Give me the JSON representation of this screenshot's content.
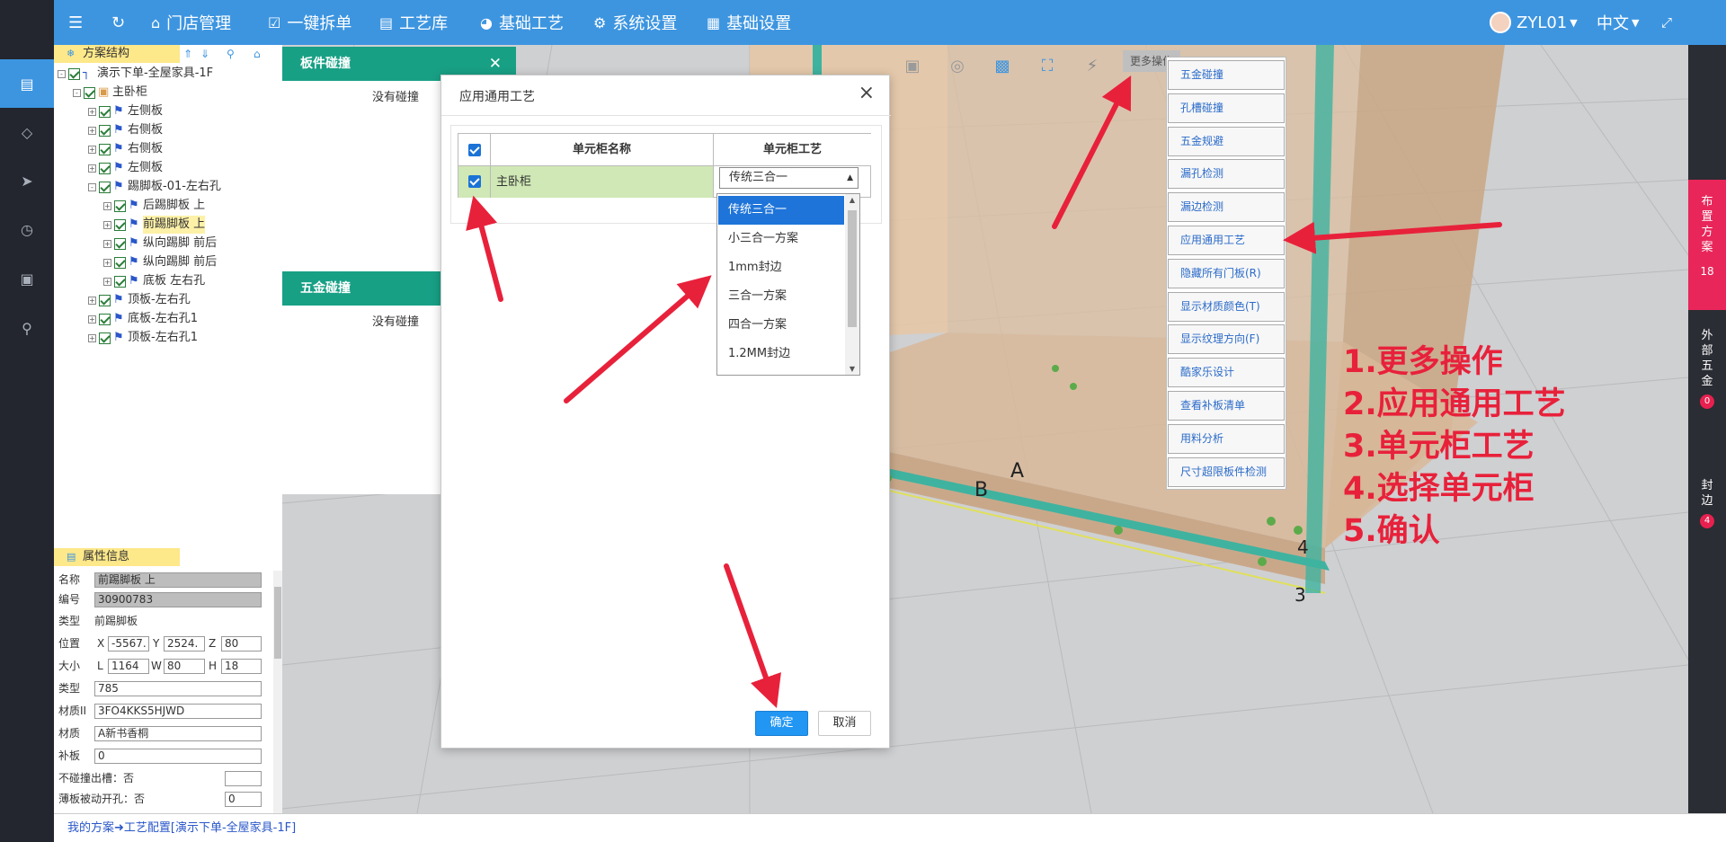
{
  "topbar": {
    "items": [
      {
        "icon": "menu-icon",
        "label": ""
      },
      {
        "icon": "refresh-icon",
        "label": ""
      },
      {
        "icon": "home-icon",
        "label": "门店管理"
      },
      {
        "icon": "shield-check-icon",
        "label": "一键拆单"
      },
      {
        "icon": "book-icon",
        "label": "工艺库"
      },
      {
        "icon": "gauge-icon",
        "label": "基础工艺"
      },
      {
        "icon": "gear-icon",
        "label": "系统设置"
      },
      {
        "icon": "grid-icon",
        "label": "基础设置"
      }
    ],
    "user": "ZYL01",
    "language": "中文",
    "color": "#3d95e0"
  },
  "left_nav_icons": [
    "layout-icon",
    "diamond-icon",
    "send-icon",
    "clock-icon",
    "trash-icon",
    "search-icon"
  ],
  "tree_panel": {
    "title": "方案结构",
    "nodes": [
      {
        "label": "演示下单-全屋家具-1F",
        "level": 0,
        "exp": "-",
        "icon": "r"
      },
      {
        "label": "主卧柜",
        "level": 1,
        "exp": "-",
        "icon": "box"
      },
      {
        "label": "左侧板",
        "level": 2,
        "exp": "+",
        "icon": "flag"
      },
      {
        "label": "右侧板",
        "level": 2,
        "exp": "+",
        "icon": "flag"
      },
      {
        "label": "右侧板",
        "level": 2,
        "exp": "+",
        "icon": "flag"
      },
      {
        "label": "左侧板",
        "level": 2,
        "exp": "+",
        "icon": "flag"
      },
      {
        "label": "踢脚板-01-左右孔",
        "level": 2,
        "exp": "-",
        "icon": "flag"
      },
      {
        "label": "后踢脚板 上",
        "level": 3,
        "exp": "+",
        "icon": "flag"
      },
      {
        "label": "前踢脚板 上",
        "level": 3,
        "exp": "+",
        "icon": "flag",
        "selected": true
      },
      {
        "label": "纵向踢脚 前后",
        "level": 3,
        "exp": "+",
        "icon": "flag"
      },
      {
        "label": "纵向踢脚 前后",
        "level": 3,
        "exp": "+",
        "icon": "flag"
      },
      {
        "label": "底板 左右孔",
        "level": 3,
        "exp": "+",
        "icon": "flag"
      },
      {
        "label": "顶板-左右孔",
        "level": 2,
        "exp": "+",
        "icon": "flag"
      },
      {
        "label": "底板-左右孔1",
        "level": 2,
        "exp": "+",
        "icon": "flag"
      },
      {
        "label": "顶板-左右孔1",
        "level": 2,
        "exp": "+",
        "icon": "flag"
      }
    ]
  },
  "props_panel": {
    "title": "属性信息",
    "name_label": "名称",
    "name_value": "前踢脚板 上",
    "code_label": "编号",
    "code_value": "30900783",
    "type_label": "类型",
    "type_value": "前踢脚板",
    "pos_label": "位置",
    "x_label": "X",
    "x_value": "-5567.",
    "y_label": "Y",
    "y_value": "2524.",
    "z_label": "Z",
    "z_value": "80",
    "size_label": "大小",
    "l_label": "L",
    "l_value": "1164",
    "w_label": "W",
    "w_value": "80",
    "h_label": "H",
    "h_value": "18",
    "kind_label": "类型",
    "kind_value": "785",
    "matid_label": "材质II",
    "matid_value": "3FO4KKS5HJWD",
    "mat_label": "材质",
    "mat_value": "A新书香桐",
    "patch_label": "补板",
    "patch_value": "0",
    "nocollide_label": "不碰撞出槽：否",
    "thin_label": "薄板被动开孔：否",
    "thin_value": "0"
  },
  "collision_panel": {
    "title": "板件碰撞",
    "message": "没有碰撞"
  },
  "hardware_panel": {
    "title": "五金碰撞",
    "message": "没有碰撞"
  },
  "dialog": {
    "title": "应用通用工艺",
    "col_name": "单元柜名称",
    "col_craft": "单元柜工艺",
    "row_name": "主卧柜",
    "selected_craft": "传统三合一",
    "options": [
      "传统三合一",
      "小三合一方案",
      "1mm封边",
      "三合一方案",
      "四合一方案",
      "1.2MM封边"
    ],
    "ok": "确定",
    "cancel": "取消"
  },
  "toolbar3d": {
    "more_label": "更多操作",
    "icons": [
      "cabinet-icon",
      "target-icon",
      "cube-icon",
      "fullscreen-icon",
      "lightning-icon"
    ]
  },
  "context_menu": [
    "五金碰撞",
    "孔槽碰撞",
    "五金规避",
    "漏孔检测",
    "漏边检测",
    "应用通用工艺",
    "隐藏所有门板(R)",
    "显示材质颜色(T)",
    "显示纹理方向(F)",
    "酷家乐设计",
    "查看补板清单",
    "用料分析",
    "尺寸超限板件检测"
  ],
  "right_panel": [
    {
      "label": "布置方案",
      "badge": "18",
      "active": true
    },
    {
      "label": "外部五金",
      "badge": "0",
      "active": false
    },
    {
      "label": "封边",
      "badge": "4",
      "active": false
    }
  ],
  "steps": [
    "1.更多操作",
    "2.应用通用工艺",
    "3.单元柜工艺",
    "4.选择单元柜",
    "5.确认"
  ],
  "scene_marks": [
    "A",
    "B",
    "4",
    "3"
  ],
  "statusbar": {
    "text": "我的方案➜工艺配置[演示下单-全屋家具-1F]"
  }
}
